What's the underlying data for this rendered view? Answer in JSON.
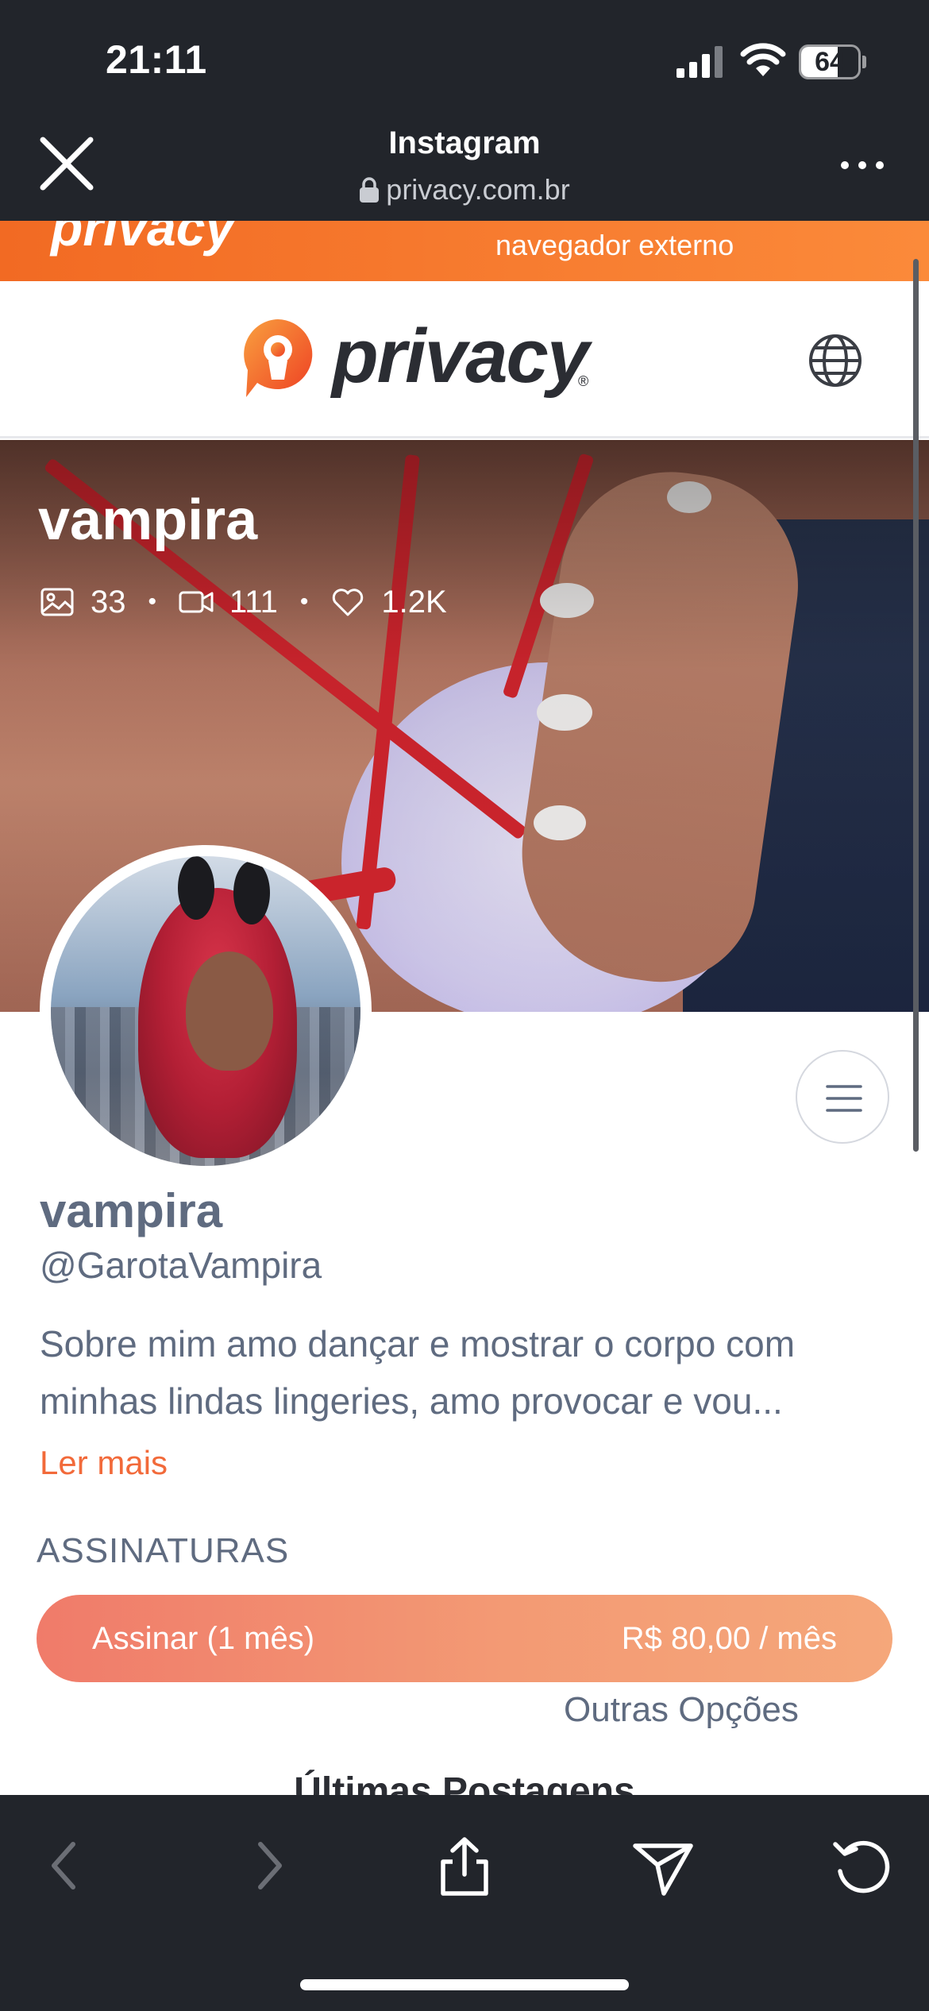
{
  "status_bar": {
    "time": "21:11",
    "battery_level": "64",
    "battery_fraction": 0.64
  },
  "browser": {
    "title": "Instagram",
    "url": "privacy.com.br"
  },
  "banner": {
    "logo_text": "privacy",
    "text": "navegador externo"
  },
  "header": {
    "logo_text": "privacy",
    "registered_mark": "®"
  },
  "cover": {
    "name": "vampira",
    "stats": {
      "photos": "33",
      "videos": "111",
      "likes": "1.2K",
      "separator": "•"
    }
  },
  "profile": {
    "name": "vampira",
    "handle": "@GarotaVampira",
    "bio": "Sobre mim amo dançar e mostrar o corpo com minhas lindas lingeries, amo provocar e vou...",
    "read_more": "Ler mais"
  },
  "subscriptions": {
    "heading": "ASSINATURAS",
    "button_label": "Assinar (1 mês)",
    "button_price": "R$ 80,00 / mês",
    "other_options": "Outras Opções"
  },
  "next_heading_peek": "Últimas Postagens",
  "colors": {
    "brand_orange": "#f26a23",
    "button_gradient_start": "#f07b6a",
    "button_gradient_end": "#f5a77a",
    "text_muted": "#5f6b80",
    "chrome_dark": "#22252b"
  },
  "icons": {
    "close": "close-icon",
    "lock": "lock-icon",
    "more": "more-icon",
    "globe": "globe-icon",
    "photo": "photo-icon",
    "video": "video-icon",
    "heart": "heart-icon",
    "menu": "menu-icon",
    "back": "back-arrow-icon",
    "forward": "forward-arrow-icon",
    "share": "share-icon",
    "send": "send-icon",
    "reload": "reload-icon"
  }
}
